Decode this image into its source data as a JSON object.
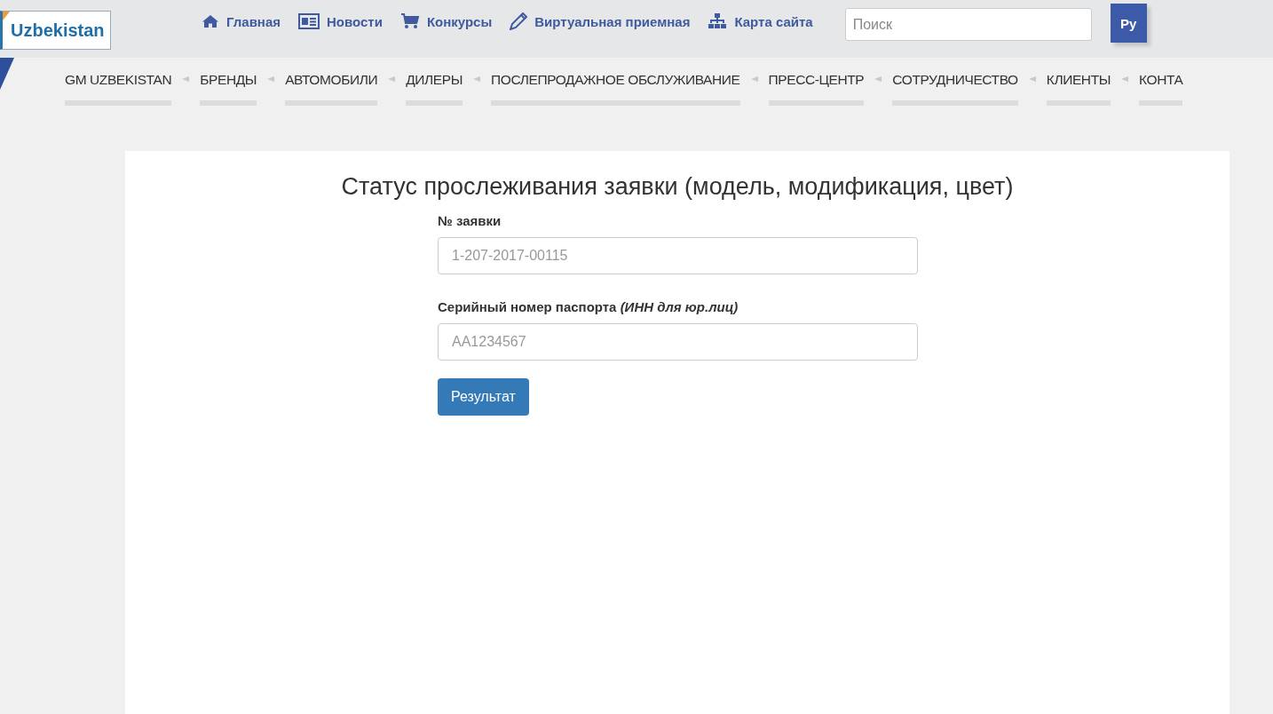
{
  "logo": {
    "text": "Uzbekistan"
  },
  "top_nav": [
    {
      "label": "Главная",
      "kind": "home"
    },
    {
      "label": "Новости",
      "kind": "news"
    },
    {
      "label": "Конкурсы",
      "kind": "cart"
    },
    {
      "label": "Виртуальная приемная",
      "kind": "pencil"
    },
    {
      "label": "Карта сайта",
      "kind": "sitemap"
    }
  ],
  "search": {
    "placeholder": "Поиск"
  },
  "language_button": "Ру",
  "main_menu": [
    "GM UZBEKISTAN",
    "БРЕНДЫ",
    "АВТОМОБИЛИ",
    "ДИЛЕРЫ",
    "ПОСЛЕПРОДАЖНОЕ ОБСЛУЖИВАНИЕ",
    "ПРЕСС-ЦЕНТР",
    "СОТРУДНИЧЕСТВО",
    "КЛИЕНТЫ",
    "КОНТА"
  ],
  "form": {
    "title": "Статус прослеживания заявки (модель, модификация, цвет)",
    "fields": [
      {
        "label": "№ заявки",
        "placeholder": "1-207-2017-00115"
      },
      {
        "label": "Серийный номер паспорта *(ИНН для юр.лиц)*",
        "placeholder": "AA1234567"
      }
    ],
    "submit": "Результат"
  }
}
